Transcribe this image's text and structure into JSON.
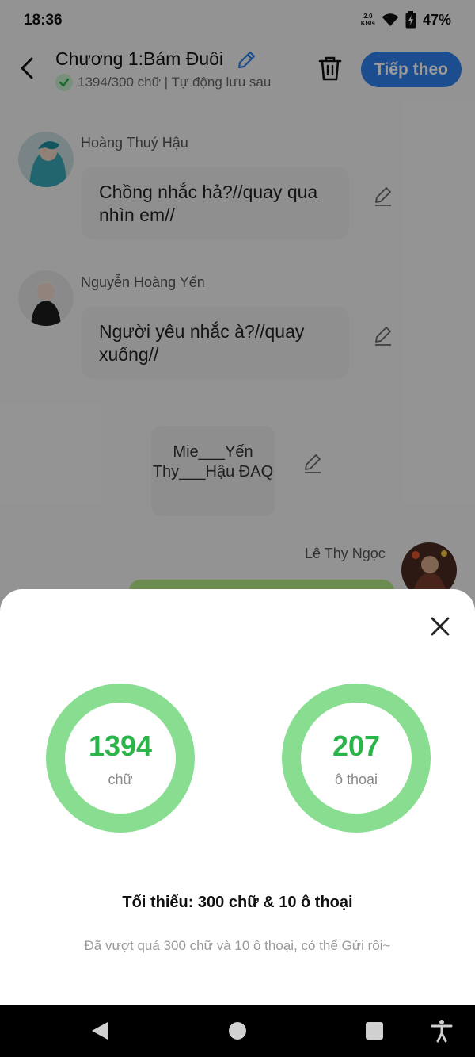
{
  "status_bar": {
    "time": "18:36",
    "net_speed_value": "2.0",
    "net_speed_unit": "KB/s",
    "battery_percent": "47%"
  },
  "header": {
    "title": "Chương 1:Bám Đuôi",
    "subtitle": "1394/300 chữ | Tự động lưu sau",
    "next_button": "Tiếp theo"
  },
  "chat": {
    "messages": [
      {
        "sender": "Hoàng Thuý Hậu",
        "text": "Chồng nhắc hả?//quay qua nhìn em//"
      },
      {
        "sender": "Nguyễn Hoàng Yến",
        "text": "Người yêu nhắc à?//quay xuống//"
      }
    ],
    "narration": "Mie___Yến Thy___Hậu ĐAQ",
    "right_sender": "Lê Thy Ngọc"
  },
  "sheet": {
    "stats": [
      {
        "value": "1394",
        "label": "chữ"
      },
      {
        "value": "207",
        "label": "ô thoại"
      }
    ],
    "minimum_text": "Tối thiểu: 300 chữ & 10 ô thoại",
    "note_text": "Đã vượt quá 300 chữ và 10 ô thoại, có thể Gửi rồi~"
  },
  "colors": {
    "accent_blue": "#2f80ed",
    "ring_green": "#88dd90",
    "value_green": "#2bb44a"
  },
  "icons": {
    "back": "back-arrow-icon",
    "edit": "pencil-icon",
    "delete": "trash-icon",
    "close": "close-icon",
    "saved": "check-icon"
  }
}
